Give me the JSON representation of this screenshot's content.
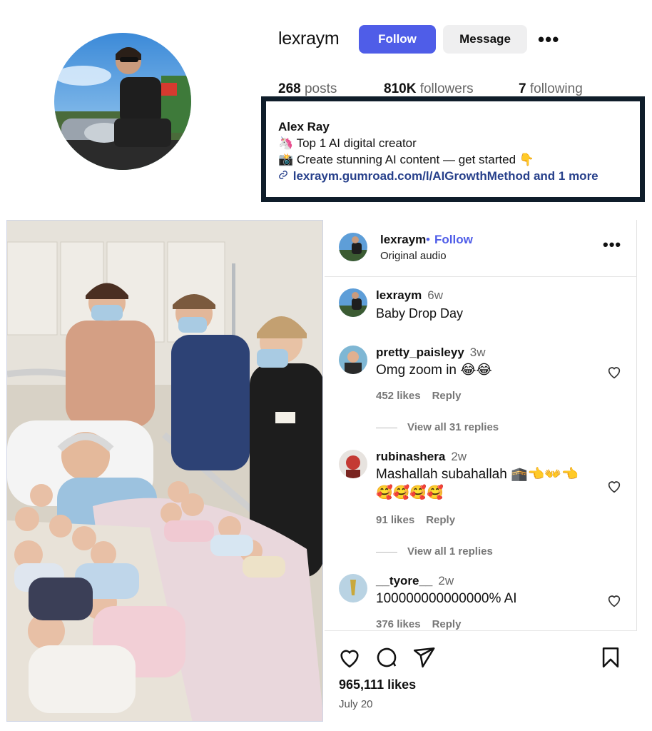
{
  "profile": {
    "username": "lexraym",
    "follow_label": "Follow",
    "message_label": "Message",
    "more_label": "•••",
    "stats": {
      "posts_value": "268",
      "posts_label": "posts",
      "followers_value": "810K",
      "followers_label": "followers",
      "following_value": "7",
      "following_label": "following"
    },
    "bio": {
      "name": "Alex Ray",
      "line1": "🦄 Top 1 AI digital creator",
      "line2": "📸 Create stunning AI content — get started 👇",
      "link": "lexraym.gumroad.com/l/AIGrowthMethod and 1 more"
    }
  },
  "post": {
    "header": {
      "username": "lexraym",
      "dot": "•",
      "follow_label": "Follow",
      "audio": "Original audio",
      "more_label": "•••"
    },
    "caption": {
      "username": "lexraym",
      "time": "6w",
      "text": "Baby Drop Day"
    },
    "comments": [
      {
        "username": "pretty_paisleyy",
        "time": "3w",
        "text": "Omg zoom in 😂😂",
        "likes": "452 likes",
        "reply": "Reply",
        "view_replies": "View all 31 replies"
      },
      {
        "username": "rubinashera",
        "time": "2w",
        "text": "Mashallah subahallah 🕋👈👐👈 🥰🥰🥰🥰",
        "likes": "91 likes",
        "reply": "Reply",
        "view_replies": "View all 1 replies"
      },
      {
        "username": "__tyore__",
        "time": "2w",
        "text": "100000000000000% AI",
        "likes": "376 likes",
        "reply": "Reply"
      }
    ],
    "likes_count": "965,111 likes",
    "date": "July 20"
  },
  "colors": {
    "accent": "#4f5de8",
    "link": "#27408b",
    "bio_box_border": "#0f1d2a"
  },
  "icons": [
    "link-icon",
    "heart-icon",
    "comment-icon",
    "share-icon",
    "bookmark-icon",
    "more-icon"
  ]
}
